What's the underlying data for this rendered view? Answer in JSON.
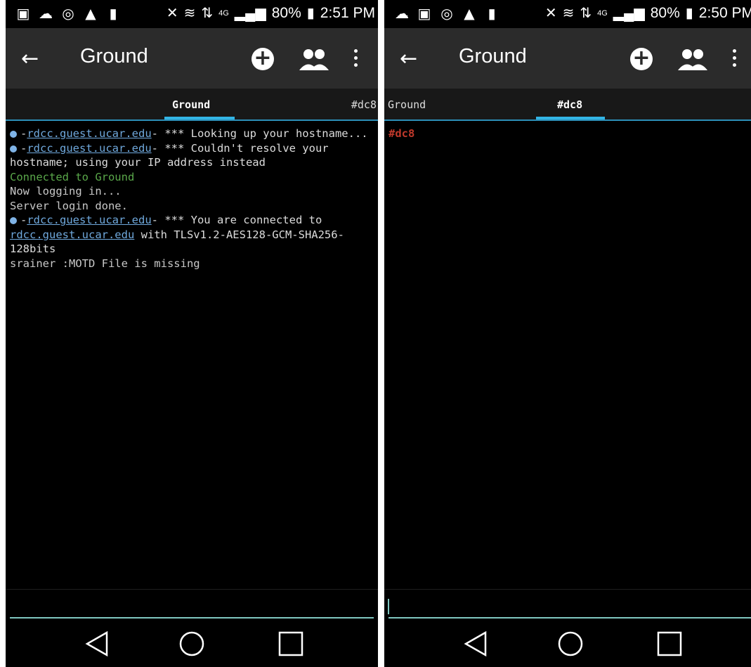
{
  "left": {
    "status": {
      "signal": "4G",
      "battery": "80%",
      "time": "2:51 PM"
    },
    "appbar": {
      "back": "←",
      "title": "Ground",
      "add": "+"
    },
    "tabs": [
      {
        "label": "Ground",
        "active": true
      },
      {
        "label": "#dc8",
        "active": false
      }
    ],
    "log": [
      {
        "type": "info",
        "link": "rdcc.guest.ucar.edu",
        "pre": "-",
        "post": "- *** Looking up your hostname..."
      },
      {
        "type": "info",
        "link": "rdcc.guest.ucar.edu",
        "pre": "-",
        "post": "- *** Couldn't resolve your hostname; using your IP address instead"
      },
      {
        "type": "green",
        "text": "Connected to Ground"
      },
      {
        "type": "gray",
        "text": "Now logging in..."
      },
      {
        "type": "gray",
        "text": "Server login done."
      },
      {
        "type": "info3",
        "link": "rdcc.guest.ucar.edu",
        "pre": "-",
        "mid": "- *** You are connected to ",
        "link2": "rdcc.guest.ucar.edu",
        "post": " with TLSv1.2-AES128-GCM-SHA256-128bits"
      },
      {
        "type": "gray",
        "text": "srainer :MOTD File is missing"
      }
    ]
  },
  "right": {
    "status": {
      "signal": "4G",
      "battery": "80%",
      "time": "2:50 PM"
    },
    "appbar": {
      "back": "←",
      "title": "Ground",
      "add": "+"
    },
    "tabs": [
      {
        "label": "Ground",
        "active": false
      },
      {
        "label": "#dc8",
        "active": true
      }
    ],
    "log": [
      {
        "type": "red",
        "text": "#dc8"
      }
    ]
  },
  "colors": {
    "accent": "#33b5e5",
    "input_line": "#7fc7c0",
    "appbar": "#2b2b2b",
    "link": "#6fa8dc",
    "green": "#5aa84a",
    "red": "#c0392b"
  },
  "icons": {
    "status_left": [
      "image-icon",
      "cloud-icon",
      "instagram-icon",
      "warning-icon",
      "unknown-icon"
    ],
    "status_right": [
      "mute-icon",
      "wifi-icon",
      "data-icon",
      "signal-icon",
      "battery-icon"
    ]
  }
}
